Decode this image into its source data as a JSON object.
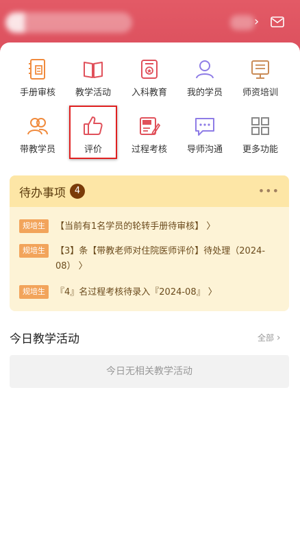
{
  "header": {
    "brand_color": "#e35a66"
  },
  "grid": [
    {
      "label": "手册审核",
      "icon": "handbook-icon"
    },
    {
      "label": "教学活动",
      "icon": "book-icon"
    },
    {
      "label": "入科教育",
      "icon": "badge-icon"
    },
    {
      "label": "我的学员",
      "icon": "user-icon"
    },
    {
      "label": "师资培训",
      "icon": "certificate-icon"
    },
    {
      "label": "带教学员",
      "icon": "group-icon"
    },
    {
      "label": "评价",
      "icon": "thumbs-up-icon"
    },
    {
      "label": "过程考核",
      "icon": "review-edit-icon"
    },
    {
      "label": "导师沟通",
      "icon": "chat-icon"
    },
    {
      "label": "更多功能",
      "icon": "grid-icon"
    }
  ],
  "todo": {
    "title": "待办事项",
    "count": "4",
    "more": "•••",
    "items": [
      {
        "tag": "规培生",
        "text": "【当前有1名学员的轮转手册待审核】 〉"
      },
      {
        "tag": "规培生",
        "text": "【3】条【带教老师对住院医师评价】待处理（2024-08） 〉"
      },
      {
        "tag": "规培生",
        "text": "『4』名过程考核待录入『2024-08』 〉"
      }
    ]
  },
  "today": {
    "title": "今日教学活动",
    "all_label": "全部",
    "empty_text": "今日无相关教学活动"
  },
  "colors": {
    "icon_orange": "#f08a3c",
    "icon_red": "#e0505a",
    "icon_purple": "#8e7ce6",
    "icon_brown": "#c98a55",
    "icon_gray": "#888888"
  }
}
